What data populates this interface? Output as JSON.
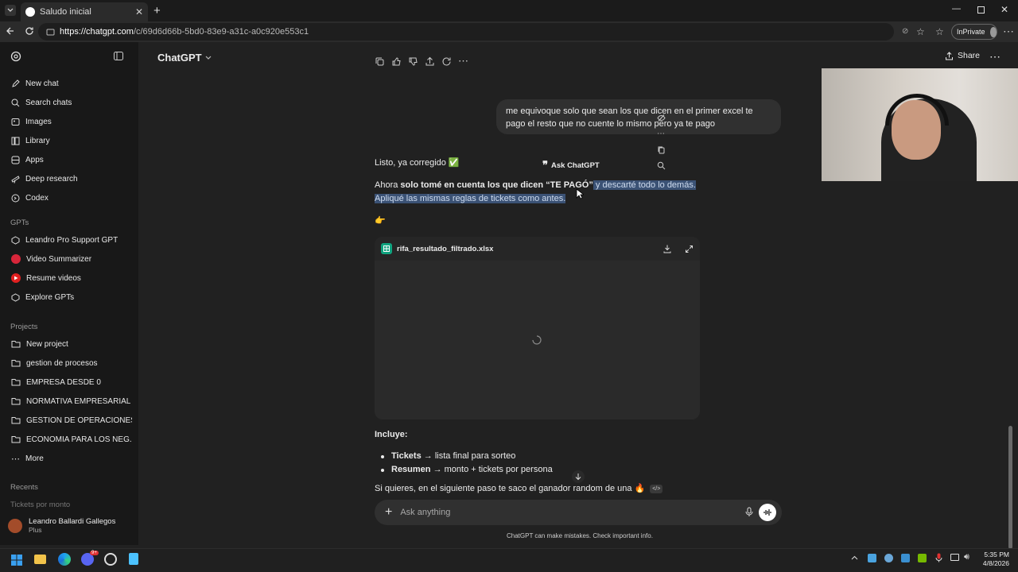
{
  "browser": {
    "tab_title": "Saludo inicial",
    "url_domain": "https://chatgpt.com",
    "url_path": "/c/69d6d66b-5bd0-83e9-a31c-a0c920e553c1",
    "inprivate_label": "InPrivate"
  },
  "sidebar": {
    "primary": [
      {
        "label": "New chat",
        "icon": "edit-icon"
      },
      {
        "label": "Search chats",
        "icon": "search-icon"
      },
      {
        "label": "Images",
        "icon": "image-icon"
      },
      {
        "label": "Library",
        "icon": "library-icon"
      },
      {
        "label": "Apps",
        "icon": "apps-icon"
      },
      {
        "label": "Deep research",
        "icon": "telescope-icon"
      },
      {
        "label": "Codex",
        "icon": "codex-icon"
      }
    ],
    "gpts_heading": "GPTs",
    "gpts": [
      {
        "label": "Leandro Pro Support GPT",
        "icon": "cube-icon"
      },
      {
        "label": "Video Summarizer",
        "icon": "video-summarizer-icon"
      },
      {
        "label": "Resume videos",
        "icon": "youtube-icon"
      },
      {
        "label": "Explore GPTs",
        "icon": "cube-icon"
      }
    ],
    "projects_heading": "Projects",
    "projects": [
      {
        "label": "New project"
      },
      {
        "label": "gestion de procesos"
      },
      {
        "label": "EMPRESA DESDE 0"
      },
      {
        "label": "NORMATIVA EMPRESARIAL"
      },
      {
        "label": "GESTION DE OPERACIONES"
      },
      {
        "label": "ECONOMIA PARA LOS NEG..."
      }
    ],
    "more_label": "More",
    "recents_heading": "Recents",
    "recent_item": "Tickets por monto",
    "user_name": "Leandro Ballardi Gallegos",
    "user_plan": "Plus"
  },
  "header": {
    "model_name": "ChatGPT",
    "share_label": "Share"
  },
  "conversation": {
    "user_message": "me equivoque solo que sean los que dicen en el primer excel te pago el resto que no cuente lo mismo pero ya te pago",
    "ask_chatgpt_label": "Ask ChatGPT",
    "reply_line1": "Listo, ya corregido ✅",
    "reply_line2_a": "Ahora ",
    "reply_line2_b": "solo tomé en cuenta los que dicen “TE PAGÓ”",
    "reply_line2_c": " y descarté todo lo demás.",
    "reply_line3": "Apliqué las mismas reglas de tickets como antes.",
    "pointing_emoji": "👉",
    "file_name": "rifa_resultado_filtrado.xlsx",
    "includes_heading": "Incluye:",
    "bullets": [
      {
        "bold": "Tickets",
        "rest": " → lista final para sorteo"
      },
      {
        "bold": "Resumen",
        "rest": " → monto + tickets por persona"
      }
    ],
    "closing_line": "Si quieres, en el siguiente paso te saco el ganador random de una 🔥"
  },
  "composer": {
    "placeholder": "Ask anything",
    "disclaimer": "ChatGPT can make mistakes. Check important info."
  },
  "taskbar": {
    "time": "5:35 PM",
    "date": "4/8/2026",
    "discord_badge": "9+"
  },
  "colors": {
    "background": "#212121",
    "sidebar": "#181818",
    "selection": "#3b5275",
    "file_icon": "#10a37f"
  }
}
